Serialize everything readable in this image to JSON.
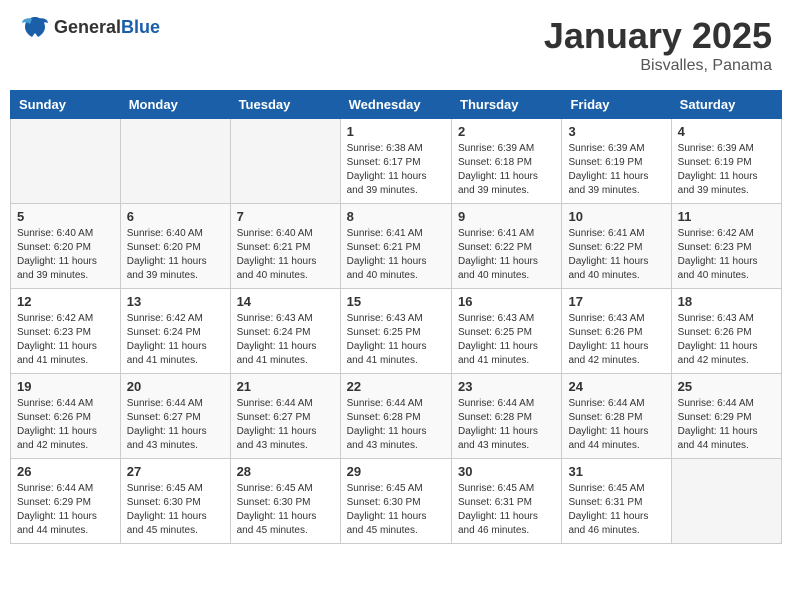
{
  "header": {
    "logo_general": "General",
    "logo_blue": "Blue",
    "month_title": "January 2025",
    "location": "Bisvalles, Panama"
  },
  "weekdays": [
    "Sunday",
    "Monday",
    "Tuesday",
    "Wednesday",
    "Thursday",
    "Friday",
    "Saturday"
  ],
  "weeks": [
    [
      {
        "day": "",
        "info": ""
      },
      {
        "day": "",
        "info": ""
      },
      {
        "day": "",
        "info": ""
      },
      {
        "day": "1",
        "info": "Sunrise: 6:38 AM\nSunset: 6:17 PM\nDaylight: 11 hours\nand 39 minutes."
      },
      {
        "day": "2",
        "info": "Sunrise: 6:39 AM\nSunset: 6:18 PM\nDaylight: 11 hours\nand 39 minutes."
      },
      {
        "day": "3",
        "info": "Sunrise: 6:39 AM\nSunset: 6:19 PM\nDaylight: 11 hours\nand 39 minutes."
      },
      {
        "day": "4",
        "info": "Sunrise: 6:39 AM\nSunset: 6:19 PM\nDaylight: 11 hours\nand 39 minutes."
      }
    ],
    [
      {
        "day": "5",
        "info": "Sunrise: 6:40 AM\nSunset: 6:20 PM\nDaylight: 11 hours\nand 39 minutes."
      },
      {
        "day": "6",
        "info": "Sunrise: 6:40 AM\nSunset: 6:20 PM\nDaylight: 11 hours\nand 39 minutes."
      },
      {
        "day": "7",
        "info": "Sunrise: 6:40 AM\nSunset: 6:21 PM\nDaylight: 11 hours\nand 40 minutes."
      },
      {
        "day": "8",
        "info": "Sunrise: 6:41 AM\nSunset: 6:21 PM\nDaylight: 11 hours\nand 40 minutes."
      },
      {
        "day": "9",
        "info": "Sunrise: 6:41 AM\nSunset: 6:22 PM\nDaylight: 11 hours\nand 40 minutes."
      },
      {
        "day": "10",
        "info": "Sunrise: 6:41 AM\nSunset: 6:22 PM\nDaylight: 11 hours\nand 40 minutes."
      },
      {
        "day": "11",
        "info": "Sunrise: 6:42 AM\nSunset: 6:23 PM\nDaylight: 11 hours\nand 40 minutes."
      }
    ],
    [
      {
        "day": "12",
        "info": "Sunrise: 6:42 AM\nSunset: 6:23 PM\nDaylight: 11 hours\nand 41 minutes."
      },
      {
        "day": "13",
        "info": "Sunrise: 6:42 AM\nSunset: 6:24 PM\nDaylight: 11 hours\nand 41 minutes."
      },
      {
        "day": "14",
        "info": "Sunrise: 6:43 AM\nSunset: 6:24 PM\nDaylight: 11 hours\nand 41 minutes."
      },
      {
        "day": "15",
        "info": "Sunrise: 6:43 AM\nSunset: 6:25 PM\nDaylight: 11 hours\nand 41 minutes."
      },
      {
        "day": "16",
        "info": "Sunrise: 6:43 AM\nSunset: 6:25 PM\nDaylight: 11 hours\nand 41 minutes."
      },
      {
        "day": "17",
        "info": "Sunrise: 6:43 AM\nSunset: 6:26 PM\nDaylight: 11 hours\nand 42 minutes."
      },
      {
        "day": "18",
        "info": "Sunrise: 6:43 AM\nSunset: 6:26 PM\nDaylight: 11 hours\nand 42 minutes."
      }
    ],
    [
      {
        "day": "19",
        "info": "Sunrise: 6:44 AM\nSunset: 6:26 PM\nDaylight: 11 hours\nand 42 minutes."
      },
      {
        "day": "20",
        "info": "Sunrise: 6:44 AM\nSunset: 6:27 PM\nDaylight: 11 hours\nand 43 minutes."
      },
      {
        "day": "21",
        "info": "Sunrise: 6:44 AM\nSunset: 6:27 PM\nDaylight: 11 hours\nand 43 minutes."
      },
      {
        "day": "22",
        "info": "Sunrise: 6:44 AM\nSunset: 6:28 PM\nDaylight: 11 hours\nand 43 minutes."
      },
      {
        "day": "23",
        "info": "Sunrise: 6:44 AM\nSunset: 6:28 PM\nDaylight: 11 hours\nand 43 minutes."
      },
      {
        "day": "24",
        "info": "Sunrise: 6:44 AM\nSunset: 6:28 PM\nDaylight: 11 hours\nand 44 minutes."
      },
      {
        "day": "25",
        "info": "Sunrise: 6:44 AM\nSunset: 6:29 PM\nDaylight: 11 hours\nand 44 minutes."
      }
    ],
    [
      {
        "day": "26",
        "info": "Sunrise: 6:44 AM\nSunset: 6:29 PM\nDaylight: 11 hours\nand 44 minutes."
      },
      {
        "day": "27",
        "info": "Sunrise: 6:45 AM\nSunset: 6:30 PM\nDaylight: 11 hours\nand 45 minutes."
      },
      {
        "day": "28",
        "info": "Sunrise: 6:45 AM\nSunset: 6:30 PM\nDaylight: 11 hours\nand 45 minutes."
      },
      {
        "day": "29",
        "info": "Sunrise: 6:45 AM\nSunset: 6:30 PM\nDaylight: 11 hours\nand 45 minutes."
      },
      {
        "day": "30",
        "info": "Sunrise: 6:45 AM\nSunset: 6:31 PM\nDaylight: 11 hours\nand 46 minutes."
      },
      {
        "day": "31",
        "info": "Sunrise: 6:45 AM\nSunset: 6:31 PM\nDaylight: 11 hours\nand 46 minutes."
      },
      {
        "day": "",
        "info": ""
      }
    ]
  ]
}
